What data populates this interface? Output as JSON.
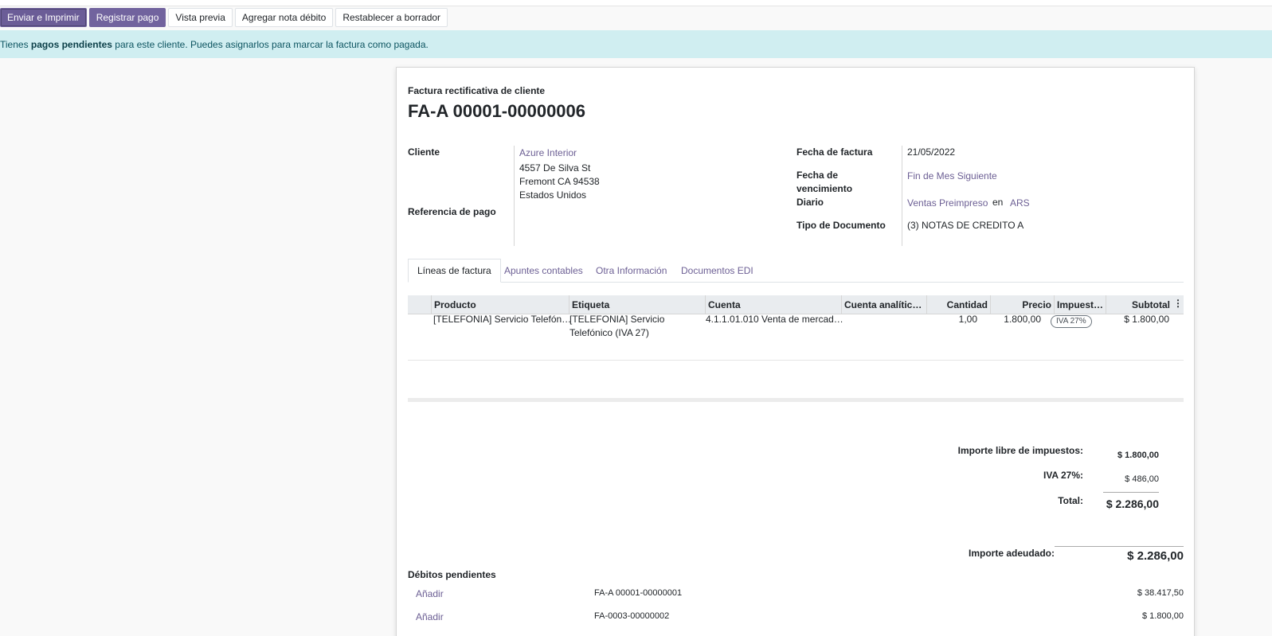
{
  "toolbar": {
    "send_print": "Enviar e Imprimir",
    "register_payment": "Registrar pago",
    "preview": "Vista previa",
    "debit_note": "Agregar nota débito",
    "reset_draft": "Restablecer a borrador"
  },
  "alert": {
    "prefix": "Tienes ",
    "bold": "pagos pendientes",
    "suffix": " para este cliente. Puedes asignarlos para marcar la factura como pagada."
  },
  "invoice": {
    "subtitle": "Factura rectificativa de cliente",
    "number": "FA-A 00001-00000006",
    "customer_label": "Cliente",
    "customer_name": "Azure Interior",
    "address1": "4557 De Silva St",
    "address2": "Fremont CA 94538",
    "address3": "Estados Unidos",
    "payment_ref_label": "Referencia de pago",
    "date_label": "Fecha de factura",
    "date_value": "21/05/2022",
    "due_label_1": "Fecha de",
    "due_label_2": "vencimiento",
    "due_value": "Fin de Mes Siguiente",
    "journal_label": "Diario",
    "journal_value": "Ventas Preimpreso",
    "journal_in": "en",
    "currency": "ARS",
    "doc_type_label": "Tipo de Documento",
    "doc_type_value": "(3) NOTAS DE CREDITO A"
  },
  "tabs": [
    "Líneas de factura",
    "Apuntes contables",
    "Otra Información",
    "Documentos EDI"
  ],
  "table": {
    "headers": [
      "Producto",
      "Etiqueta",
      "Cuenta",
      "Cuenta analític…",
      "Cantidad",
      "Precio",
      "Impuest…",
      "Subtotal"
    ],
    "row": {
      "product": "[TELEFONIA] Servicio Telefón…",
      "label_1": "[TELEFONIA] Servicio",
      "label_2": "Telefónico (IVA 27)",
      "account": "4.1.1.01.010 Venta de mercad…",
      "quantity": "1,00",
      "price": "1.800,00",
      "tax": "IVA 27%",
      "subtotal": "$ 1.800,00"
    }
  },
  "totals": {
    "untaxed_label": "Importe libre de impuestos:",
    "untaxed_value": "$ 1.800,00",
    "tax_label": "IVA 27%:",
    "tax_value": "$ 486,00",
    "total_label": "Total:",
    "total_value": "$ 2.286,00",
    "due_label": "Importe adeudado:",
    "due_value": "$ 2.286,00"
  },
  "pending": {
    "title": "Débitos pendientes",
    "items": [
      {
        "action": "Añadir",
        "ref": "FA-A 00001-00000001",
        "amount": "$ 38.417,50"
      },
      {
        "action": "Añadir",
        "ref": "FA-0003-00000002",
        "amount": "$ 1.800,00"
      }
    ]
  }
}
